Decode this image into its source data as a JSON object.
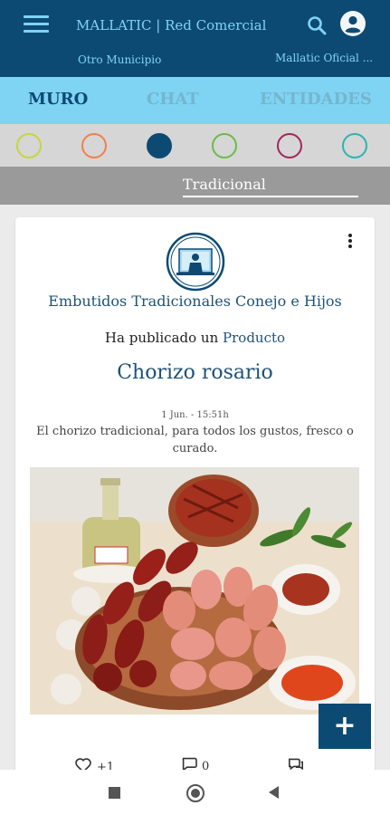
{
  "header": {
    "title": "MALLATIC | Red Comercial",
    "municipio": "Otro Municipio",
    "oficial": "Mallatic Oficial ..."
  },
  "tabs": [
    {
      "label": "MURO",
      "active": true
    },
    {
      "label": "CHAT",
      "active": false
    },
    {
      "label": "ENTIDADES",
      "active": false
    }
  ],
  "filter_circles": [
    {
      "color": "#c8d53a",
      "filled": false
    },
    {
      "color": "#f08049",
      "filled": false
    },
    {
      "color": "#0d4a73",
      "filled": true
    },
    {
      "color": "#6abb48",
      "filled": false
    },
    {
      "color": "#a02859",
      "filled": false
    },
    {
      "color": "#2db4b0",
      "filled": false
    }
  ],
  "category": {
    "label": "Tradicional"
  },
  "post": {
    "entity_name": "Embutidos Tradicionales Conejo e Hijos",
    "published_prefix": "Ha publicado un",
    "published_type": "Producto",
    "title": "Chorizo rosario",
    "timestamp": "1 Jun. - 15:51h",
    "description": "El chorizo tradicional, para todos los gustos, fresco o curado.",
    "likes": "+1",
    "comments": "0"
  },
  "icons": {
    "menu": "menu-icon",
    "search": "search-icon",
    "profile": "account-circle-icon",
    "more": "more-vertical-icon",
    "like": "heart-outline-icon",
    "comment": "chat-bubble-outline-icon",
    "share": "share-icon",
    "add": "plus-icon"
  },
  "colors": {
    "primary": "#0d4a73",
    "accent": "#7fd3f3",
    "text_link": "#1e5277"
  }
}
